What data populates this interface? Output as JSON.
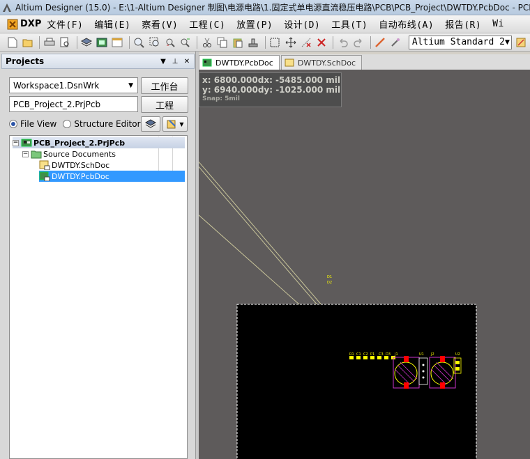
{
  "title_bar": {
    "text": "Altium Designer (15.0) - E:\\1-Altium Designer 制图\\电源电路\\1.固定式单电源直流稳压电路\\PCB\\PCB_Project\\DWTDY.PcbDoc - PCB_Project_2.PrjPcb"
  },
  "menu": {
    "dxp": "DXP",
    "items": [
      "文件(F)",
      "编辑(E)",
      "察看(V)",
      "工程(C)",
      "放置(P)",
      "设计(D)",
      "工具(T)",
      "自动布线(A)",
      "报告(R)",
      "Wi"
    ]
  },
  "toolbar": {
    "standard_combo": "Altium Standard 2"
  },
  "projects_panel": {
    "title": "Projects",
    "workspace_value": "Workspace1.DsnWrk",
    "workspace_button": "工作台",
    "project_value": "PCB_Project_2.PrjPcb",
    "project_button": "工程",
    "file_view_label": "File View",
    "structure_editor_label": "Structure Editor",
    "tree": {
      "project": "PCB_Project_2.PrjPcb",
      "folder": "Source Documents",
      "docs": [
        "DWTDY.SchDoc",
        "DWTDY.PcbDoc"
      ]
    }
  },
  "doc_tabs": [
    "DWTDY.PcbDoc",
    "DWTDY.SchDoc"
  ],
  "hud": {
    "x": "x:  6800.000",
    "dx": "dx: -5485.000  mil",
    "y": "y:  6940.000",
    "dy": "dy: -1025.000  mil",
    "snap": "Snap: 5mil"
  },
  "pcb_labels": {
    "designators": [
      "R1",
      "C1",
      "C2",
      "P1",
      "C3",
      "D3",
      "J1",
      "U1",
      "J2",
      "U2"
    ],
    "stray_labels": [
      "D1",
      "D2"
    ]
  },
  "colors": {
    "canvas_bg": "#5e5b5b",
    "board_bg": "#000000",
    "selection_blue": "#3399ff",
    "silk_yellow": "#ffff00",
    "pad_red": "#ff0000",
    "outline_magenta": "#cc33cc"
  }
}
